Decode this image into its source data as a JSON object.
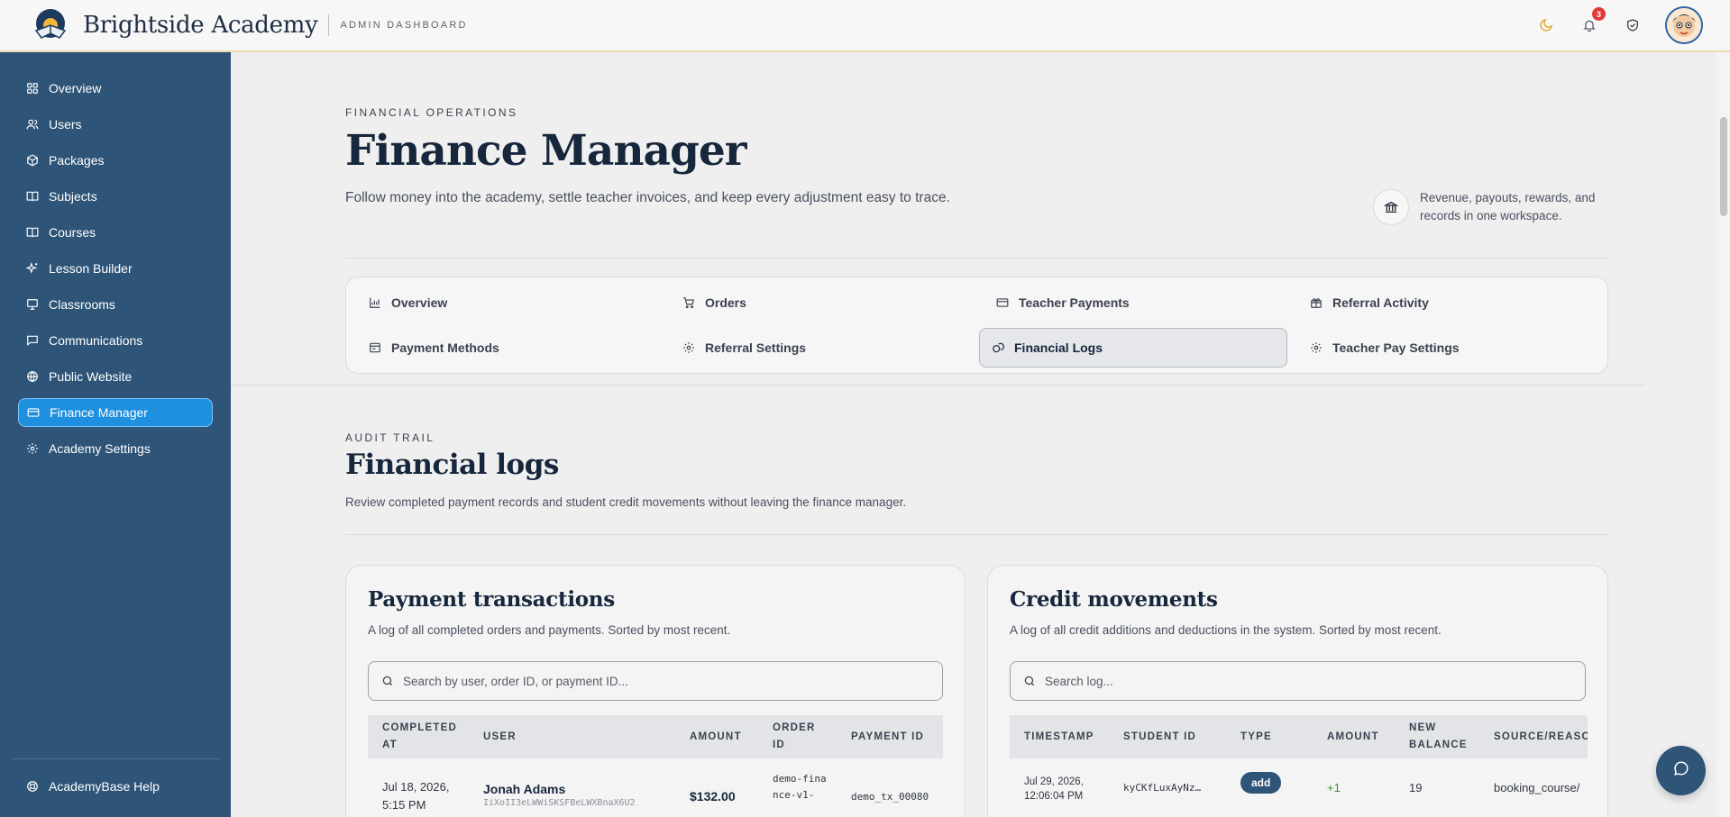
{
  "brand": {
    "name": "Brightside Academy",
    "subtitle": "ADMIN DASHBOARD"
  },
  "topbar": {
    "notification_count": "3",
    "icons": [
      "moon-icon",
      "bell-icon",
      "shield-icon",
      "avatar"
    ]
  },
  "sidebar": {
    "items": [
      {
        "label": "Overview",
        "icon": "grid-icon"
      },
      {
        "label": "Users",
        "icon": "users-icon"
      },
      {
        "label": "Packages",
        "icon": "package-icon"
      },
      {
        "label": "Subjects",
        "icon": "book-icon"
      },
      {
        "label": "Courses",
        "icon": "book-open-icon"
      },
      {
        "label": "Lesson Builder",
        "icon": "sparkles-icon"
      },
      {
        "label": "Classrooms",
        "icon": "presentation-icon"
      },
      {
        "label": "Communications",
        "icon": "message-icon"
      },
      {
        "label": "Public Website",
        "icon": "globe-icon"
      },
      {
        "label": "Finance Manager",
        "icon": "credit-card-icon",
        "active": true
      },
      {
        "label": "Academy Settings",
        "icon": "gear-icon"
      }
    ],
    "help": {
      "label": "AcademyBase Help",
      "icon": "help-icon"
    }
  },
  "header": {
    "eyebrow": "FINANCIAL OPERATIONS",
    "title": "Finance Manager",
    "description": "Follow money into the academy, settle teacher invoices, and keep every adjustment easy to trace.",
    "info": "Revenue, payouts, rewards, and records in one workspace."
  },
  "tabs": [
    {
      "label": "Overview",
      "icon": "bar-chart-icon"
    },
    {
      "label": "Orders",
      "icon": "cart-icon"
    },
    {
      "label": "Teacher Payments",
      "icon": "card-icon"
    },
    {
      "label": "Referral Activity",
      "icon": "gift-icon"
    },
    {
      "label": "Payment Methods",
      "icon": "wallet-icon"
    },
    {
      "label": "Referral Settings",
      "icon": "gear-icon"
    },
    {
      "label": "Financial Logs",
      "icon": "coins-icon",
      "active": true
    },
    {
      "label": "Teacher Pay Settings",
      "icon": "gear-icon"
    }
  ],
  "section": {
    "eyebrow": "AUDIT TRAIL",
    "title": "Financial logs",
    "description": "Review completed payment records and student credit movements without leaving the finance manager."
  },
  "payments": {
    "title": "Payment transactions",
    "description": "A log of all completed orders and payments. Sorted by most recent.",
    "search_placeholder": "Search by user, order ID, or payment ID...",
    "columns": [
      "COMPLETED AT",
      "USER",
      "AMOUNT",
      "ORDER ID",
      "PAYMENT ID"
    ],
    "rows": [
      {
        "completed_at": "Jul 18, 2026, 5:15 PM",
        "user": "Jonah Adams",
        "user_id": "IiXoII3eLWWiSKSFBeLWXBnaX6U2",
        "amount": "$132.00",
        "order_id": "demo-finance-v1-",
        "payment_id": "demo_tx_00080"
      }
    ]
  },
  "credits": {
    "title": "Credit movements",
    "description": "A log of all credit additions and deductions in the system. Sorted by most recent.",
    "search_placeholder": "Search log...",
    "columns": [
      "TIMESTAMP",
      "STUDENT ID",
      "TYPE",
      "AMOUNT",
      "NEW BALANCE",
      "SOURCE/REASON"
    ],
    "rows": [
      {
        "timestamp": "Jul 29, 2026, 12:06:04 PM",
        "student_id": "kyCKfLuxAyNz…",
        "type": "add",
        "amount": "+1",
        "new_balance": "19",
        "source": "booking_course/"
      }
    ]
  },
  "colors": {
    "sidebar": "#2e5478",
    "active_nav": "#1f8fe0",
    "accent_positive": "#3f8f3a",
    "badge": "#e23a3a"
  }
}
